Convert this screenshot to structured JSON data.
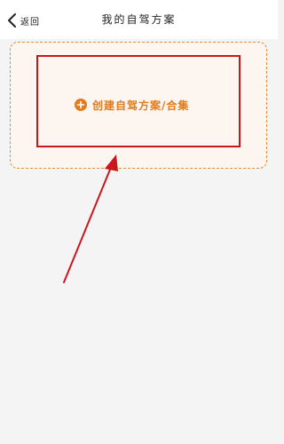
{
  "header": {
    "back_label": "返回",
    "title": "我的自驾方案"
  },
  "create_card": {
    "label": "创建自驾方案/合集"
  },
  "icons": {
    "back": "chevron-left-icon",
    "create": "plus-circle-icon"
  },
  "colors": {
    "accent": "#e07b1e",
    "card_border": "#e08e38",
    "card_background": "#fdf5ef",
    "annotation": "#c8161d",
    "page_background": "#f4f4f4"
  }
}
